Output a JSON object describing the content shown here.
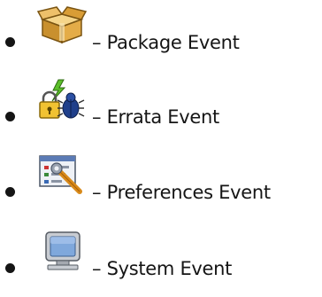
{
  "legend": {
    "items": [
      {
        "icon": "package-box-icon",
        "label": "– Package Event"
      },
      {
        "icon": "errata-bug-lock-icon",
        "label": "– Errata Event"
      },
      {
        "icon": "preferences-wrench-icon",
        "label": "– Preferences Event"
      },
      {
        "icon": "system-monitor-icon",
        "label": "– System Event"
      }
    ]
  }
}
